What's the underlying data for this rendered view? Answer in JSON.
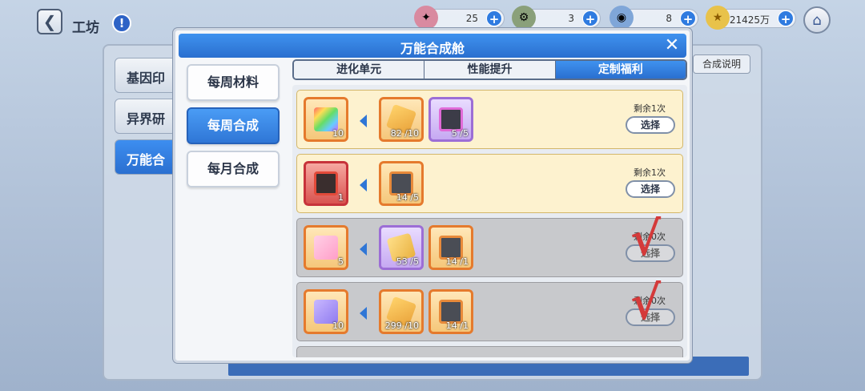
{
  "background": {
    "back_icon": "chevron-left-icon",
    "page_title": "工坊",
    "info_icon": "!",
    "resources": [
      {
        "icon": "ticket-icon",
        "value": "25"
      },
      {
        "icon": "cog-box-icon",
        "value": "3"
      },
      {
        "icon": "orb-icon",
        "value": "8"
      },
      {
        "icon": "coin-icon",
        "value": "21425万"
      }
    ],
    "plus": "+",
    "home_icon": "home-icon",
    "side_items": [
      "基因印",
      "异界研",
      "万能合"
    ],
    "help_button": "合成说明"
  },
  "modal": {
    "title": "万能合成舱",
    "close": "✕",
    "side_tabs": [
      "每周材料",
      "每周合成",
      "每月合成"
    ],
    "active_side_tab": 1,
    "top_tabs": [
      "进化单元",
      "性能提升",
      "定制福利"
    ],
    "active_top_tab": 2,
    "rows": [
      {
        "status": "available",
        "target": {
          "count": "10",
          "kind": "rainbow-ticket"
        },
        "materials": [
          {
            "count": "82 /10",
            "kind": "gold-shard"
          },
          {
            "count": "5 /5",
            "kind": "purple-tablet"
          }
        ],
        "remain": "剩余1次",
        "button": "选择",
        "mark": ""
      },
      {
        "status": "available",
        "target": {
          "count": "1",
          "kind": "red-chip"
        },
        "materials": [
          {
            "count": "14 /5",
            "kind": "dark-chip"
          }
        ],
        "remain": "剩余1次",
        "button": "选择",
        "mark": ""
      },
      {
        "status": "used",
        "target": {
          "count": "5",
          "kind": "pink-ticket"
        },
        "materials": [
          {
            "count": "53 /5",
            "kind": "gold-shard"
          },
          {
            "count": "14 /1",
            "kind": "dark-chip"
          }
        ],
        "remain": "剩余0次",
        "button": "选择",
        "mark": "√"
      },
      {
        "status": "used",
        "target": {
          "count": "10",
          "kind": "violet-ticket"
        },
        "materials": [
          {
            "count": "299 /10",
            "kind": "gold-shard"
          },
          {
            "count": "14 /1",
            "kind": "dark-chip"
          }
        ],
        "remain": "剩余0次",
        "button": "选择",
        "mark": "√"
      }
    ]
  },
  "colors": {
    "accent": "#2f76d6",
    "row_available": "#fdf2cf",
    "row_used": "#c8c9cc",
    "check_mark": "#d43a3a"
  }
}
